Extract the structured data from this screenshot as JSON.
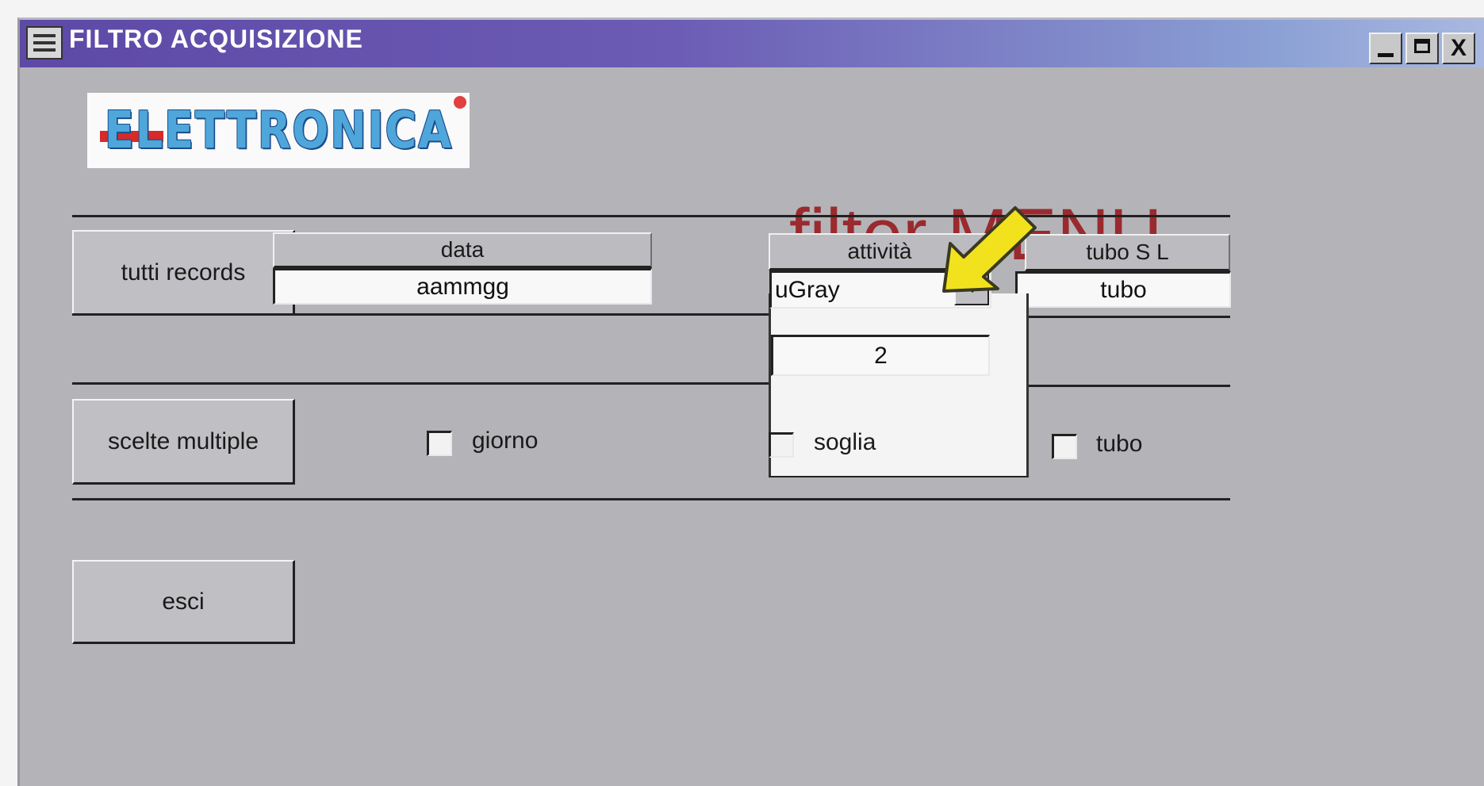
{
  "window": {
    "title": "FILTRO ACQUISIZIONE",
    "icon": "system-menu-icon",
    "controls": {
      "minimize": "",
      "maximize": "",
      "close": "X"
    }
  },
  "logo": {
    "text": "ELETTRONICA"
  },
  "heading": "filter MENU",
  "buttons": {
    "all_records": "tutti records",
    "multiple_choices": "scelte multiple",
    "exit": "esci"
  },
  "columns": {
    "data": {
      "header": "data",
      "value": "aammgg"
    },
    "attivita": {
      "header": "attività",
      "selected": "uGray",
      "threshold": "2"
    },
    "tubo": {
      "header": "tubo S L",
      "value": "tubo"
    }
  },
  "checkboxes": [
    {
      "label": "giorno",
      "checked": false
    },
    {
      "label": "soglia",
      "checked": false
    },
    {
      "label": "tubo",
      "checked": false
    }
  ],
  "colors": {
    "titlebar_start": "#5d49a6",
    "titlebar_end": "#a8b8e0",
    "window_bg": "#b4b4b8",
    "heading": "#9a2a2e",
    "logo": "#4fa6da",
    "pointer_arrow": "#f2e21e"
  },
  "annotation": {
    "icon": "yellow-pointer-arrow"
  }
}
